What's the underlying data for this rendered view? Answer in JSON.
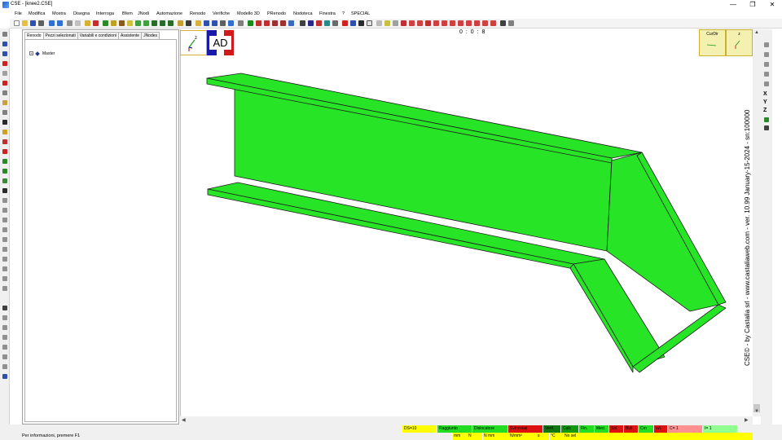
{
  "window": {
    "title": "CSE - [knee2.CSE]",
    "controls": [
      "—",
      "❐",
      "✕"
    ]
  },
  "menu": [
    "File",
    "Modifica",
    "Mostra",
    "Disegna",
    "Interroga",
    "Bfem",
    "JNodi",
    "Automazione",
    "Renodo",
    "Verifiche",
    "Modello 3D",
    "PRenodo",
    "Nodoteca",
    "Finestra",
    "?",
    "SPECIAL"
  ],
  "mdi_controls": [
    "—",
    "❐",
    "✕"
  ],
  "panel": {
    "tabs": [
      "Renodo",
      "Pezzi selezionati",
      "Variabili e condizioni",
      "Assistente",
      "JNodes"
    ],
    "tree_root": "Master"
  },
  "viewport": {
    "counter": "0 : 0 : 8",
    "axis_label": "z",
    "view_label": "AD",
    "cur_dir_label": "CurDir",
    "z_box_label": "z",
    "watermark": "CSE© - by Castalia srl - www.castaliaweb.com - ver. 10.99 January-15-2024 - sn:100000",
    "model_color": "#27e427"
  },
  "right_toolbar_letters": [
    "X",
    "Y",
    "Z"
  ],
  "status": {
    "info": "Per informazioni, premere F1",
    "indicators": [
      {
        "label": "DS=10",
        "color": "#ffff00"
      },
      {
        "label": "Raggiunto",
        "color": "#22dd22"
      },
      {
        "label": "Dislocatore",
        "color": "#22dd22"
      },
      {
        "label": "Svincolati",
        "color": "#dd1111"
      },
      {
        "label": "Verif.",
        "color": "#117711"
      },
      {
        "label": "Calc",
        "color": "#119911"
      },
      {
        "label": "Fin.",
        "color": "#22dd22"
      },
      {
        "label": "Med.",
        "color": "#22dd22"
      },
      {
        "label": "Sol.",
        "color": "#dd1111"
      },
      {
        "label": "Bull.",
        "color": "#dd1111"
      },
      {
        "label": "Crn",
        "color": "#22dd22"
      },
      {
        "label": "Wl.",
        "color": "#dd1111"
      },
      {
        "label": "C= 1",
        "color": "#ff9090"
      },
      {
        "label": "I= 1",
        "color": "#90ff90"
      }
    ],
    "units": [
      "mm",
      "N",
      "N mm",
      "N/mm²",
      "s",
      "°C",
      "No sel"
    ]
  }
}
